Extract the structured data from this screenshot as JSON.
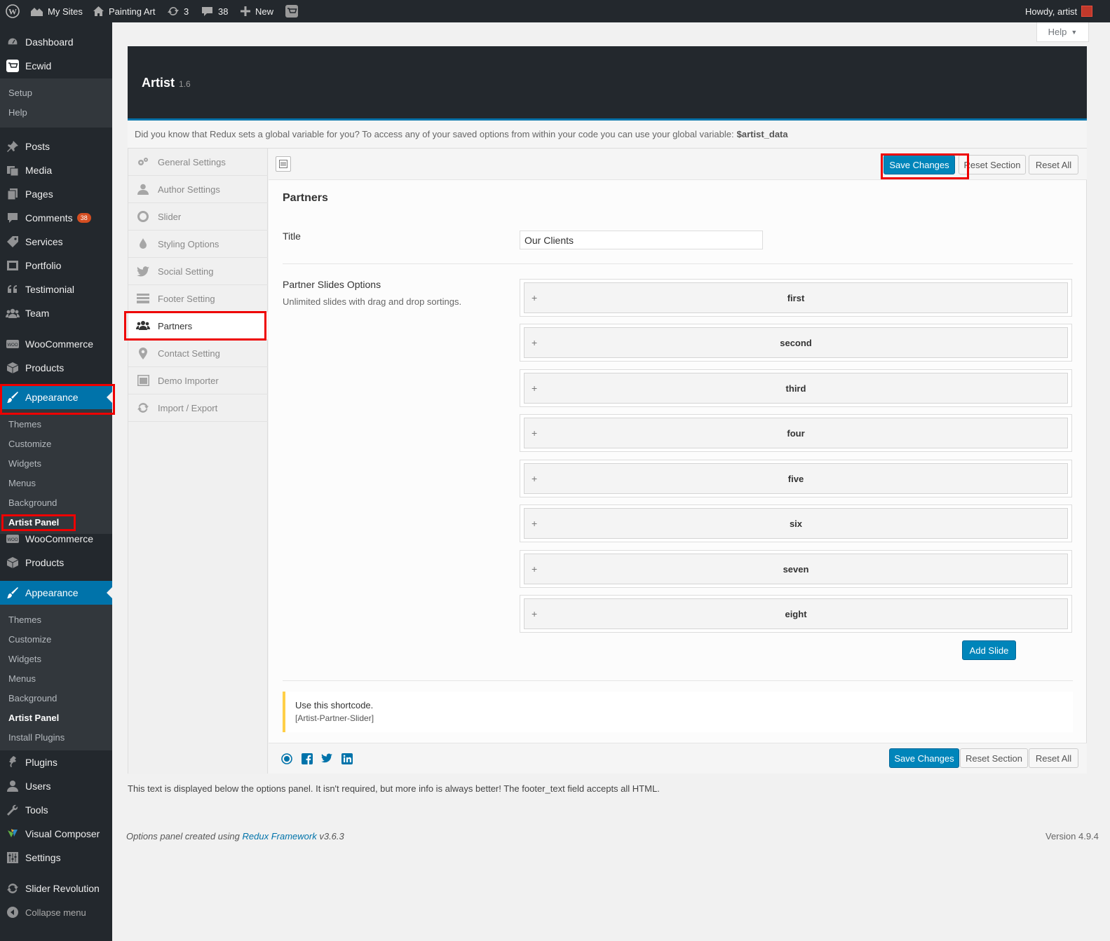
{
  "admin_bar": {
    "my_sites": "My Sites",
    "site_name": "Painting Art",
    "updates": "3",
    "comments": "38",
    "new": "New",
    "howdy": "Howdy, artist"
  },
  "sidebar": {
    "dashboard": "Dashboard",
    "ecwid": "Ecwid",
    "ecwid_sub": [
      "Setup",
      "Help"
    ],
    "posts": "Posts",
    "media": "Media",
    "pages": "Pages",
    "comments": "Comments",
    "comments_badge": "38",
    "services": "Services",
    "portfolio": "Portfolio",
    "testimonial": "Testimonial",
    "team": "Team",
    "woocommerce": "WooCommerce",
    "products": "Products",
    "appearance": "Appearance",
    "appearance_sub1": [
      "Themes",
      "Customize",
      "Widgets",
      "Menus",
      "Background",
      "Artist Panel"
    ],
    "woocommerce2": "WooCommerce",
    "products2": "Products",
    "appearance2": "Appearance",
    "appearance_sub2": [
      "Themes",
      "Customize",
      "Widgets",
      "Menus",
      "Background",
      "Artist Panel",
      "Install Plugins"
    ],
    "plugins": "Plugins",
    "users": "Users",
    "tools": "Tools",
    "visual_composer": "Visual Composer",
    "settings": "Settings",
    "slider_revolution": "Slider Revolution",
    "collapse": "Collapse menu"
  },
  "help_button": "Help",
  "panel": {
    "title": "Artist",
    "version": "1.6",
    "notice": "Did you know that Redux sets a global variable for you? To access any of your saved options from within your code you can use your global variable:",
    "notice_var": "$artist_data"
  },
  "tabs": [
    "General Settings",
    "Author Settings",
    "Slider",
    "Styling Options",
    "Social Setting",
    "Footer Setting",
    "Partners",
    "Contact Setting",
    "Demo Importer",
    "Import / Export"
  ],
  "buttons": {
    "save": "Save Changes",
    "reset_section": "Reset Section",
    "reset_all": "Reset All",
    "add_slide": "Add Slide"
  },
  "section": {
    "title": "Partners",
    "title_label": "Title",
    "title_value": "Our Clients",
    "slides_label": "Partner Slides Options",
    "slides_desc": "Unlimited slides with drag and drop sortings.",
    "slides": [
      "first",
      "second",
      "third",
      "four",
      "five",
      "six",
      "seven",
      "eight"
    ],
    "shortcode_label": "Use this shortcode.",
    "shortcode": "[Artist-Partner-Slider]"
  },
  "footer_text": "This text is displayed below the options panel. It isn't required, but more info is always better! The footer_text field accepts all HTML.",
  "credit_prefix": "Options panel created using",
  "credit_link": "Redux Framework",
  "credit_suffix": "v3.6.3",
  "wp_version": "Version 4.9.4",
  "colors": {
    "accent": "#0073aa",
    "admin_bg": "#23282d",
    "highlight": "#e00000",
    "notice_bar": "#ffcf47"
  }
}
